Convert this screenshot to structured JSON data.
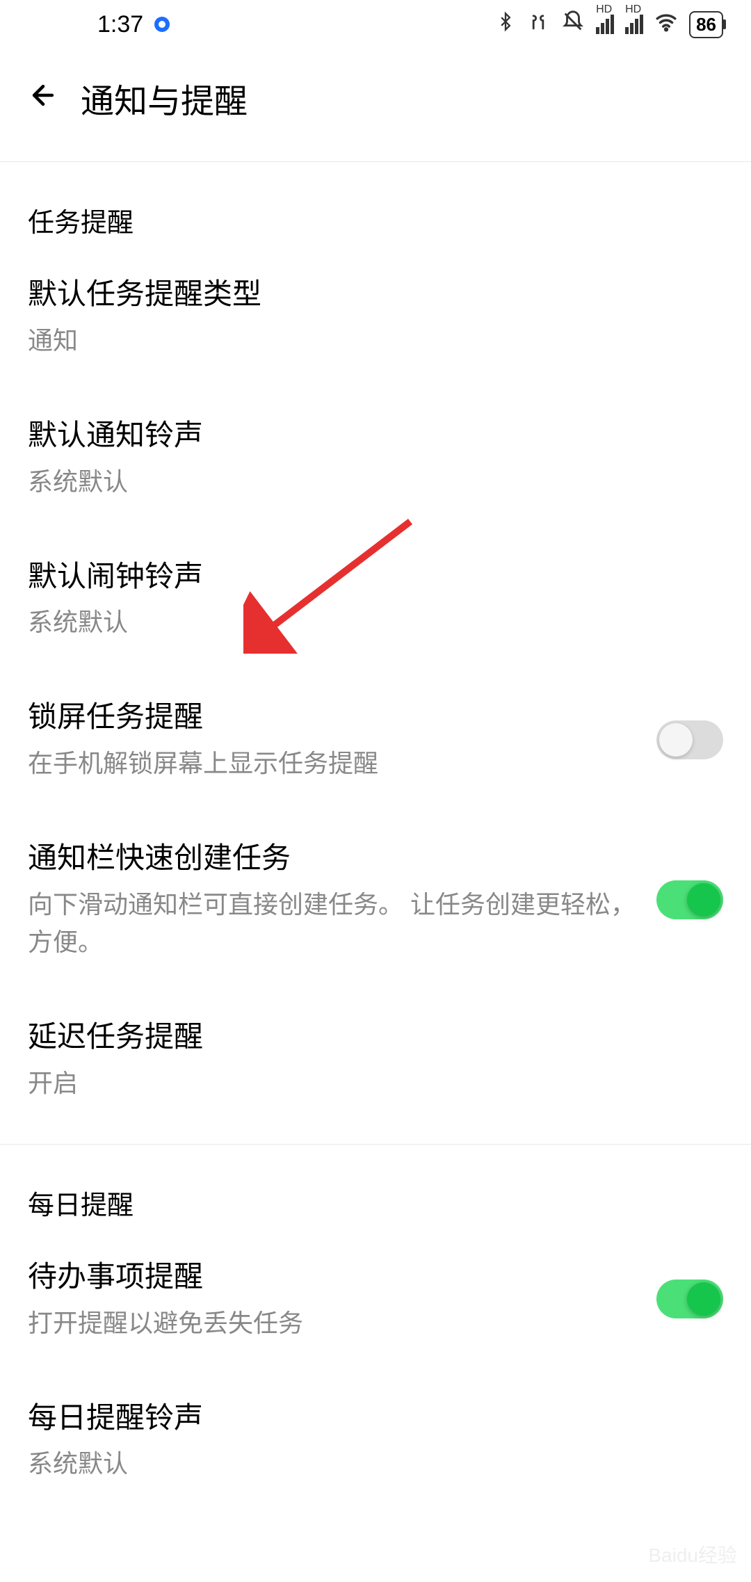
{
  "status": {
    "time": "1:37",
    "battery": "86"
  },
  "header": {
    "title": "通知与提醒"
  },
  "sections": {
    "tasks": {
      "header": "任务提醒",
      "items": [
        {
          "title": "默认任务提醒类型",
          "subtitle": "通知"
        },
        {
          "title": "默认通知铃声",
          "subtitle": "系统默认"
        },
        {
          "title": "默认闹钟铃声",
          "subtitle": "系统默认"
        },
        {
          "title": "锁屏任务提醒",
          "subtitle": "在手机解锁屏幕上显示任务提醒",
          "toggle": false
        },
        {
          "title": "通知栏快速创建任务",
          "subtitle": "向下滑动通知栏可直接创建任务。 让任务创建更轻松，方便。",
          "toggle": true
        },
        {
          "title": "延迟任务提醒",
          "subtitle": "开启"
        }
      ]
    },
    "daily": {
      "header": "每日提醒",
      "items": [
        {
          "title": "待办事项提醒",
          "subtitle": "打开提醒以避免丢失任务",
          "toggle": true
        },
        {
          "title": "每日提醒铃声",
          "subtitle": "系统默认"
        }
      ]
    }
  },
  "watermark": "Baidu经验"
}
